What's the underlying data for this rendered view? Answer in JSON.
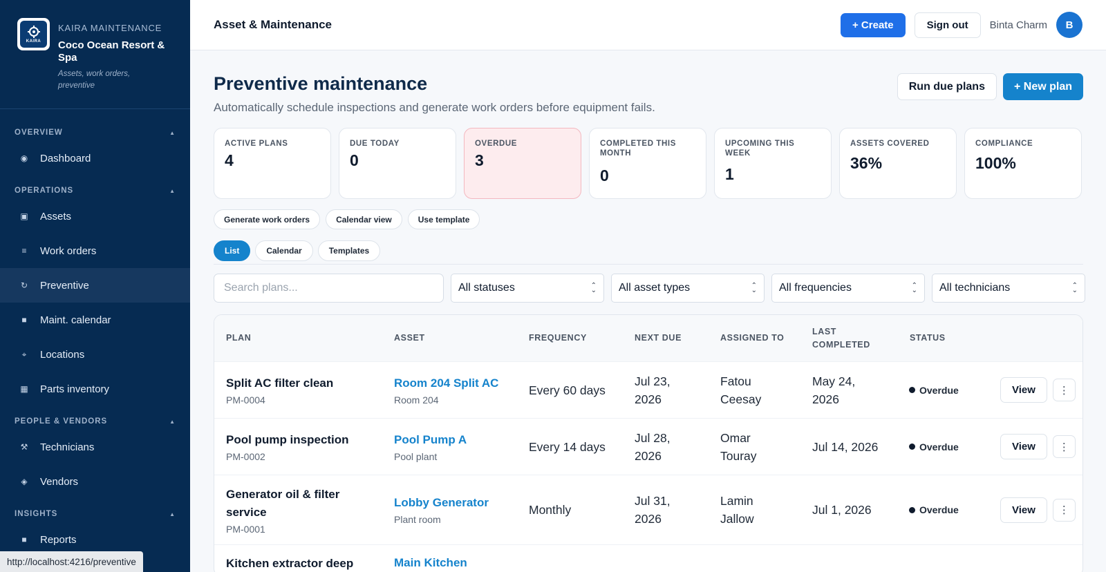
{
  "brand": {
    "kicker": "KAIRA MAINTENANCE",
    "name": "Coco Ocean Resort & Spa",
    "subtitle": "Assets, work orders, preventive",
    "logo_text": "KAIRA"
  },
  "sidebar": {
    "sections": [
      {
        "title": "OVERVIEW",
        "items": [
          {
            "label": "Dashboard",
            "icon": "dashboard-icon"
          }
        ]
      },
      {
        "title": "OPERATIONS",
        "items": [
          {
            "label": "Assets",
            "icon": "assets-icon"
          },
          {
            "label": "Work orders",
            "icon": "list-icon"
          },
          {
            "label": "Preventive",
            "icon": "refresh-icon",
            "active": true
          },
          {
            "label": "Maint. calendar",
            "icon": "calendar-icon"
          },
          {
            "label": "Locations",
            "icon": "location-icon"
          },
          {
            "label": "Parts inventory",
            "icon": "box-icon"
          }
        ]
      },
      {
        "title": "PEOPLE & VENDORS",
        "items": [
          {
            "label": "Technicians",
            "icon": "tools-icon"
          },
          {
            "label": "Vendors",
            "icon": "diamond-icon"
          }
        ]
      },
      {
        "title": "INSIGHTS",
        "items": [
          {
            "label": "Reports",
            "icon": "reports-icon"
          }
        ]
      }
    ]
  },
  "status_url": "http://localhost:4216/preventive",
  "header": {
    "title": "Asset & Maintenance",
    "create_label": "+ Create",
    "signout_label": "Sign out",
    "user_name": "Binta Charm",
    "user_initial": "B"
  },
  "page": {
    "title": "Preventive maintenance",
    "subtitle": "Automatically schedule inspections and generate work orders before equipment fails.",
    "run_due_label": "Run due plans",
    "new_plan_label": "+ New plan"
  },
  "stats": [
    {
      "label": "ACTIVE PLANS",
      "value": "4"
    },
    {
      "label": "DUE TODAY",
      "value": "0"
    },
    {
      "label": "OVERDUE",
      "value": "3"
    },
    {
      "label": "COMPLETED THIS MONTH",
      "value": "0"
    },
    {
      "label": "UPCOMING THIS WEEK",
      "value": "1"
    },
    {
      "label": "ASSETS COVERED",
      "value": "36%"
    },
    {
      "label": "COMPLIANCE",
      "value": "100%"
    }
  ],
  "quick_actions": [
    "Generate work orders",
    "Calendar view",
    "Use template"
  ],
  "tabs": [
    "List",
    "Calendar",
    "Templates"
  ],
  "filters": {
    "search_placeholder": "Search plans...",
    "status": "All statuses",
    "asset_type": "All asset types",
    "frequency": "All frequencies",
    "technician": "All technicians"
  },
  "table": {
    "columns": [
      "PLAN",
      "ASSET",
      "FREQUENCY",
      "NEXT DUE",
      "ASSIGNED TO",
      "LAST COMPLETED",
      "STATUS"
    ],
    "view_label": "View",
    "more_glyph": "⋮",
    "rows": [
      {
        "plan": "Split AC filter clean",
        "code": "PM-0004",
        "asset": "Room 204 Split AC",
        "location": "Room 204",
        "frequency": "Every 60 days",
        "next_due": "Jul 23, 2026",
        "assigned": "Fatou Ceesay",
        "last": "May 24, 2026",
        "status": "Overdue"
      },
      {
        "plan": "Pool pump inspection",
        "code": "PM-0002",
        "asset": "Pool Pump A",
        "location": "Pool plant",
        "frequency": "Every 14 days",
        "next_due": "Jul 28, 2026",
        "assigned": "Omar Touray",
        "last": "Jul 14, 2026",
        "status": "Overdue"
      },
      {
        "plan": "Generator oil & filter service",
        "code": "PM-0001",
        "asset": "Lobby Generator",
        "location": "Plant room",
        "frequency": "Monthly",
        "next_due": "Jul 31, 2026",
        "assigned": "Lamin Jallow",
        "last": "Jul 1, 2026",
        "status": "Overdue"
      },
      {
        "plan": "Kitchen extractor deep",
        "asset": "Main Kitchen"
      }
    ]
  }
}
